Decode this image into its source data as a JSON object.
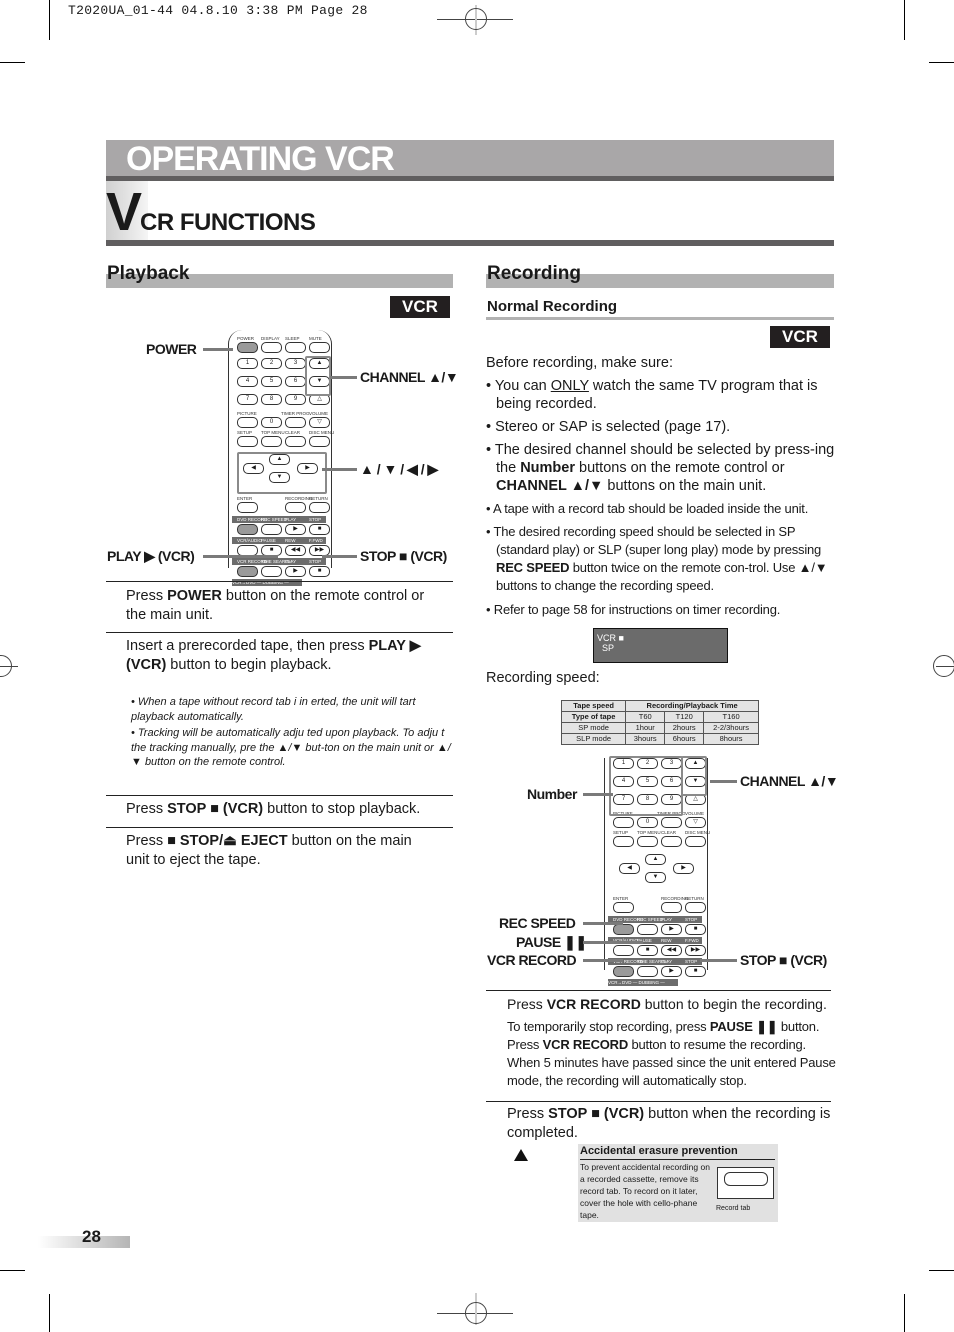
{
  "slug": "T2020UA_01-44   04.8.10 3:38 PM   Page 28",
  "header": {
    "title": "OPERATING VCR",
    "drop_cap": "V",
    "subtitle_rest": "CR FUNCTIONS"
  },
  "playback": {
    "heading": "Playback",
    "badge": "VCR",
    "callouts": {
      "power": "POWER",
      "channel": "CHANNEL ▲/▼",
      "arrows": "▲ / ▼ / ◀ / ▶",
      "play": "PLAY ▶ (VCR)",
      "stop": "STOP ■ (VCR)"
    },
    "steps": [
      {
        "pre": "Press ",
        "bold": "POWER",
        "post": " button on the remote control or the main unit."
      },
      {
        "pre": "Insert a prerecorded tape, then press ",
        "bold": "PLAY ▶ (VCR)",
        "post": " button to begin playback."
      },
      {
        "pre": "Press ",
        "bold": "STOP ■ (VCR)",
        "post": " button to stop playback."
      },
      {
        "pre": "Press ",
        "bold": "■ STOP/⏏ EJECT",
        "post": " button on the main unit to eject the tape."
      }
    ],
    "notes": [
      "• When a tape without record tab i   in  erted, the unit will   tart playback automatically.",
      "• Tracking will be automatically adju  ted upon playback. To adju  t the tracking manually, pre    the              ▲/▼ but-ton   on the main unit or               ▲/▼ button   on the remote control."
    ]
  },
  "recording": {
    "heading": "Recording",
    "subheading": "Normal Recording",
    "badge": "VCR",
    "intro": "Before recording, make sure:",
    "bullets": [
      {
        "pre": "• You can ",
        "underline": "ONLY",
        "post": " watch the same TV program that is being recorded."
      },
      {
        "text": "• Stereo or SAP is selected (page 17)."
      },
      {
        "pre": "• The desired channel should be selected by press-ing the ",
        "bold1": "Number",
        "mid": " buttons on the remote control or ",
        "bold2": "CHANNEL ▲/▼",
        "post": " buttons on the main unit."
      },
      {
        "text": "• A tape with a record tab should be loaded inside the unit."
      },
      {
        "pre": "• The desired recording speed should be selected in SP (standard play) or SLP (super long play) mode by pressing ",
        "bold1": "REC SPEED",
        "post": " button twice on the remote con-trol. Use ▲/▼ buttons to change the recording speed."
      },
      {
        "text": "• Refer to page 58 for instructions on timer recording."
      }
    ],
    "osd": {
      "line1": "VCR ■",
      "line2": "SP"
    },
    "speed_label": "Recording speed:",
    "speed_table": {
      "header_left_top": "Tape speed",
      "header_left_bottom": "Type of tape",
      "header_right": "Recording/Playback Time",
      "tapes": [
        "T60",
        "T120",
        "T160"
      ],
      "rows": [
        {
          "mode": "SP mode",
          "values": [
            "1hour",
            "2hours",
            "2-2/3hours"
          ]
        },
        {
          "mode": "SLP mode",
          "values": [
            "3hours",
            "6hours",
            "8hours"
          ]
        }
      ]
    },
    "callouts": {
      "number": "Number",
      "channel": "CHANNEL ▲/▼",
      "rec_speed": "REC SPEED",
      "pause": "PAUSE ❚❚",
      "vcr_record": "VCR RECORD",
      "stop": "STOP ■ (VCR)"
    },
    "steps": [
      {
        "pre": "Press ",
        "bold": "VCR RECORD",
        "post": " button to begin the recording."
      },
      {
        "pre": "Press ",
        "bold": "STOP ■ (VCR)",
        "post": " button when the recording is completed."
      }
    ],
    "pause_note": {
      "p1": "To temporarily stop recording, press ",
      "b1": "PAUSE ❚❚",
      "p2": " button. Press ",
      "b2": "VCR RECORD",
      "p3": " button to resume the recording. When 5 minutes have passed since the unit entered Pause mode, the recording will automatically stop."
    },
    "caution": {
      "title": "Accidental erasure prevention",
      "text": "To  prevent accidental recording on a recorded cassette, remove its record tab. To record on it later, cover the hole with cello-phane tape.",
      "tab_label": "Record tab"
    }
  },
  "remote_labels": {
    "top_row": [
      "POWER",
      "DISPLAY",
      "SLEEP",
      "MUTE"
    ],
    "digits": [
      "1",
      "2",
      "3",
      "4",
      "5",
      "6",
      "7",
      "8",
      "9",
      "0"
    ],
    "row_labels": [
      "PICTURE",
      "TIMER PROG.",
      "VOLUME"
    ],
    "menu_row": [
      "SETUP",
      "TOP MENU",
      "CLEAR",
      "DISC MENU"
    ],
    "enter_row": [
      "ENTER",
      "RECORDING",
      "RETURN"
    ],
    "strip1": [
      "DVD RECORD",
      "REC SPEED",
      "PLAY",
      "STOP"
    ],
    "strip2": [
      "VCR/AUDIO",
      "PAUSE",
      "REW",
      "F.FWD"
    ],
    "strip3": [
      "VCR RECORD",
      "TIME SEARCH",
      "PLAY",
      "STOP"
    ],
    "strip4": "VCR→DVD — DUBBING — VCR←DVD"
  },
  "page_number": "28"
}
